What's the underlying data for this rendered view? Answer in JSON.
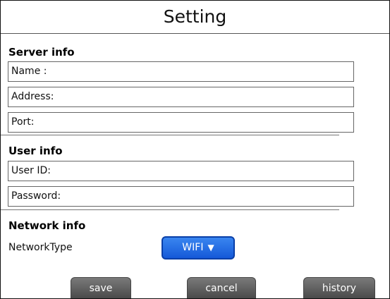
{
  "screen": {
    "title": "Setting"
  },
  "server_info": {
    "heading": "Server info",
    "name_label": "Name :",
    "address_label": "Address:",
    "port_label": "Port:"
  },
  "user_info": {
    "heading": "User info",
    "user_id_label": "User ID:",
    "password_label": "Password:"
  },
  "network_info": {
    "heading": "Network info",
    "network_type_label": "NetworkType",
    "network_type_value": "WIFI",
    "dropdown_color": "#1d63e0"
  },
  "actions": {
    "save_label": "save",
    "cancel_label": "cancel",
    "history_label": "history"
  }
}
